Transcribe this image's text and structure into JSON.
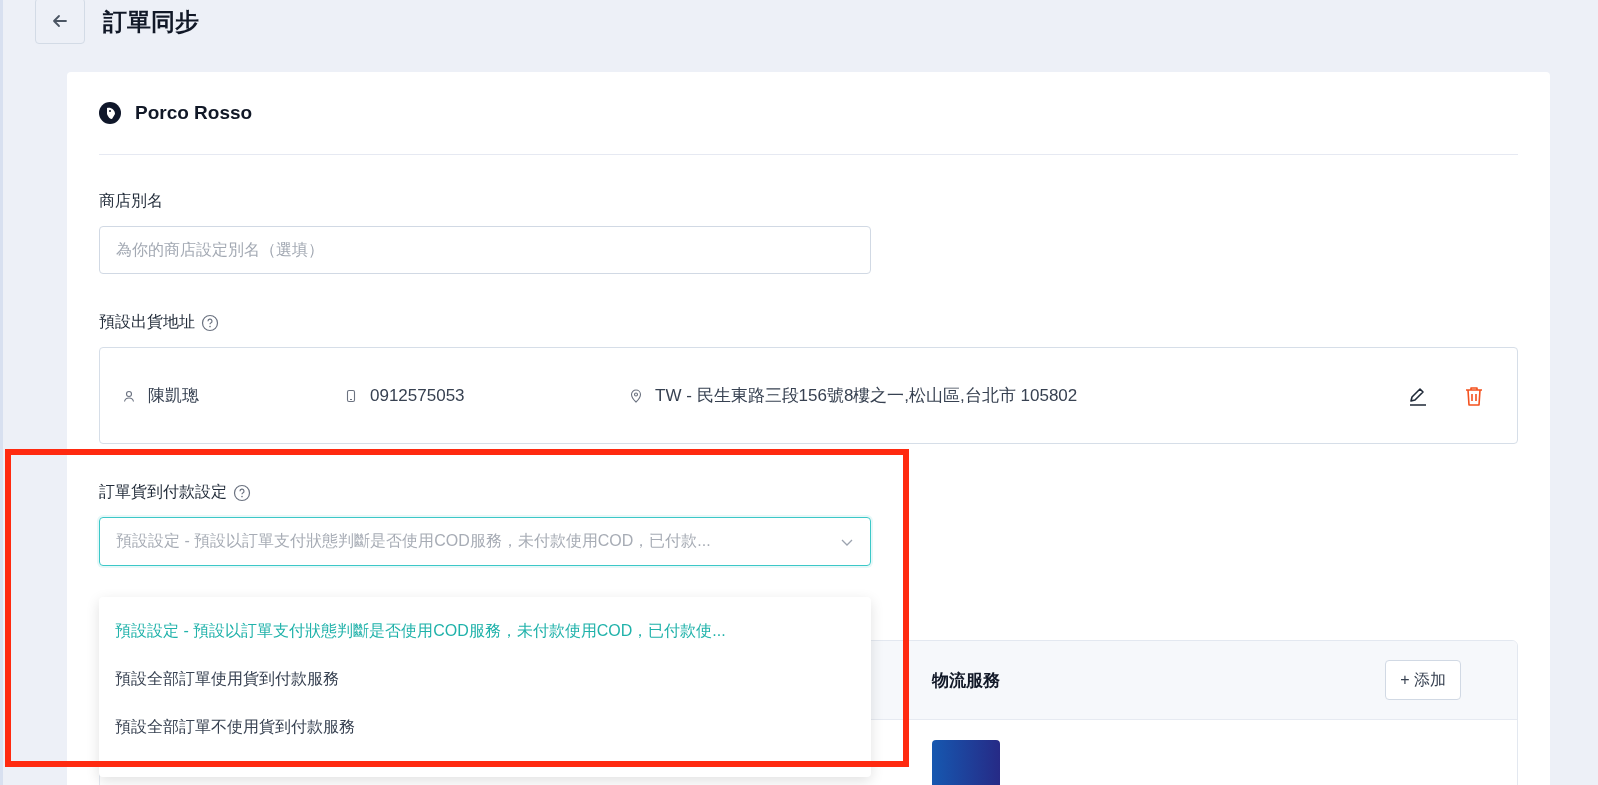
{
  "header": {
    "title": "訂單同步"
  },
  "store": {
    "name": "Porco Rosso"
  },
  "alias": {
    "label": "商店別名",
    "placeholder": "為你的商店設定別名（選填）"
  },
  "address_section": {
    "label": "預設出貨地址",
    "contact": "陳凱璁",
    "phone": "0912575053",
    "address": "TW - 民生東路三段156號8樓之一,松山區,台北市 105802"
  },
  "cod_setting": {
    "label": "訂單貨到付款設定",
    "value": "預設設定 - 預設以訂單支付狀態判斷是否使用COD服務，未付款使用COD，已付款...",
    "expanded": true,
    "options": [
      {
        "label": "預設設定 - 預設以訂單支付狀態判斷是否使用COD服務，未付款使用COD，已付款使...",
        "selected": true
      },
      {
        "label": "預設全部訂單使用貨到付款服務",
        "selected": false
      },
      {
        "label": "預設全部訂單不使用貨到付款服務",
        "selected": false
      }
    ]
  },
  "logistics": {
    "title": "物流服務",
    "add_button": "+ 添加"
  }
}
